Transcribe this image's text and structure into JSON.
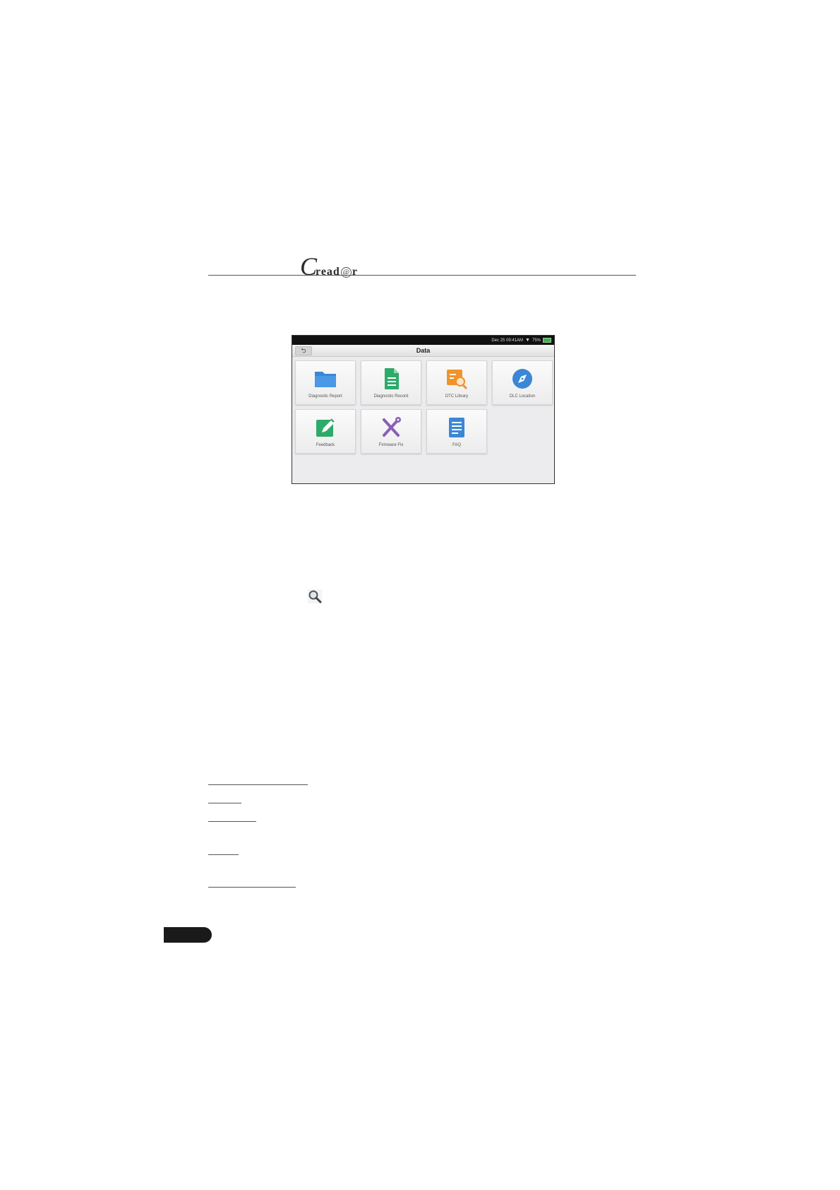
{
  "header": {
    "logo_initial": "C",
    "logo_part1": "read",
    "logo_at": "@",
    "logo_part2": "r"
  },
  "screen": {
    "status": "Dec 25 09:41AM",
    "battery": "75%",
    "back_glyph": "⮌",
    "title": "Data",
    "tiles": [
      {
        "label": "Diagnostic Report",
        "icon": "folder-icon",
        "color": "#3a87d6"
      },
      {
        "label": "Diagnostic Record",
        "icon": "document-icon",
        "color": "#2eaa6b"
      },
      {
        "label": "DTC Library",
        "icon": "dtc-search-icon",
        "color": "#f0932b"
      },
      {
        "label": "DLC Location",
        "icon": "compass-icon",
        "color": "#3a87d6"
      },
      {
        "label": "Feedback",
        "icon": "edit-icon",
        "color": "#2eaa6b"
      },
      {
        "label": "Firmware Fix",
        "icon": "tools-icon",
        "color": "#8a5fb6"
      },
      {
        "label": "FAQ",
        "icon": "list-icon",
        "color": "#3a87d6"
      }
    ]
  }
}
